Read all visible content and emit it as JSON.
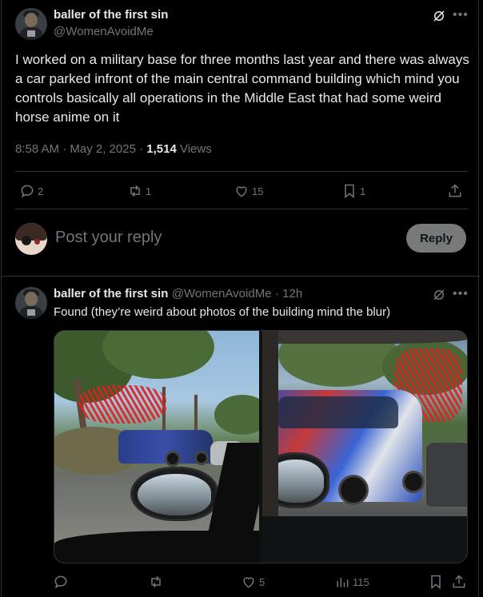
{
  "post": {
    "author_name": "baller of the first sin",
    "author_handle": "@WomenAvoidMe",
    "text": "I worked on a military base for three months last year and there was always a car parked infront of the main central command building which mind you controls basically all operations in the Middle East that had some weird horse anime on it",
    "timestamp": "8:58 AM · May 2, 2025 · ",
    "views_count": "1,514",
    "views_label": " Views",
    "actions": {
      "replies": "2",
      "reposts": "1",
      "likes": "15",
      "bookmarks": "1"
    }
  },
  "composer": {
    "placeholder": "Post your reply",
    "button_label": "Reply"
  },
  "reply": {
    "author_name": "baller of the first sin",
    "author_handle": "@WomenAvoidMe",
    "time": "· 12h",
    "text": "Found (they’re weird about photos of the building mind the blur)",
    "actions": {
      "replies": "",
      "reposts": "",
      "likes": "5",
      "views": "115"
    }
  },
  "icons": {
    "grok": "grok-icon",
    "more": "more-icon",
    "reply": "reply-icon",
    "repost": "repost-icon",
    "like": "heart-icon",
    "bookmark": "bookmark-icon",
    "share": "share-icon",
    "views": "views-icon"
  },
  "colors": {
    "background": "#000000",
    "text": "#e7e9ea",
    "muted": "#71767b",
    "border": "#2f3336",
    "reply_button": "#787a7a"
  }
}
